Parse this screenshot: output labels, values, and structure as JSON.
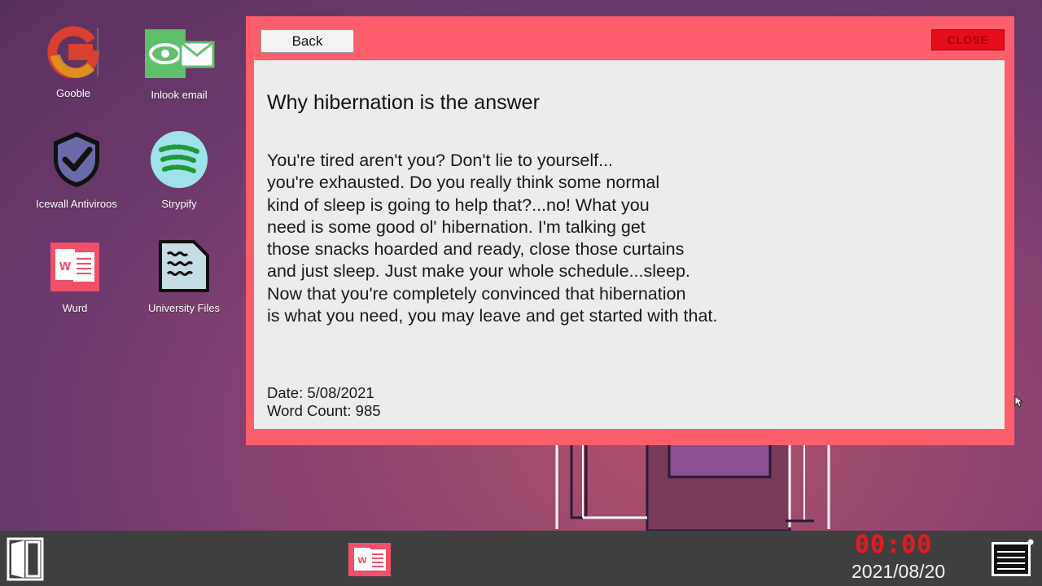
{
  "desktop": {
    "icons": [
      {
        "label": "Gooble",
        "icon": "gooble-icon"
      },
      {
        "label": "Inlook email",
        "icon": "inlook-email-icon"
      },
      {
        "label": "Icewall Antiviroos",
        "icon": "shield-icon"
      },
      {
        "label": "Strypify",
        "icon": "strypify-icon"
      },
      {
        "label": "Wurd",
        "icon": "wurd-icon"
      },
      {
        "label": "University Files",
        "icon": "document-icon"
      }
    ]
  },
  "window": {
    "back_label": "Back",
    "close_label": "CLOSE",
    "title": "Why hibernation is the answer",
    "body_lines": [
      "You're tired aren't you? Don't lie to yourself...",
      "you're exhausted. Do you really think some normal",
      "kind of sleep is going to help that?...no! What you",
      "need is some good ol' hibernation. I'm talking get",
      "those snacks hoarded and ready, close those curtains",
      "and just sleep. Just make your whole schedule...sleep.",
      "Now that you're completely convinced that hibernation",
      "is what you need, you may leave and get started with that."
    ],
    "date_line": "Date: 5/08/2021",
    "word_count_line": "Word Count: 985"
  },
  "taskbar": {
    "clock": "00:00",
    "date": "2021/08/20",
    "active_app_icon": "wurd-icon"
  },
  "colors": {
    "window_frame": "#fc5e6c",
    "close_button": "#e50d1a",
    "clock": "#e01b24",
    "taskbar": "#3f3f3f"
  }
}
